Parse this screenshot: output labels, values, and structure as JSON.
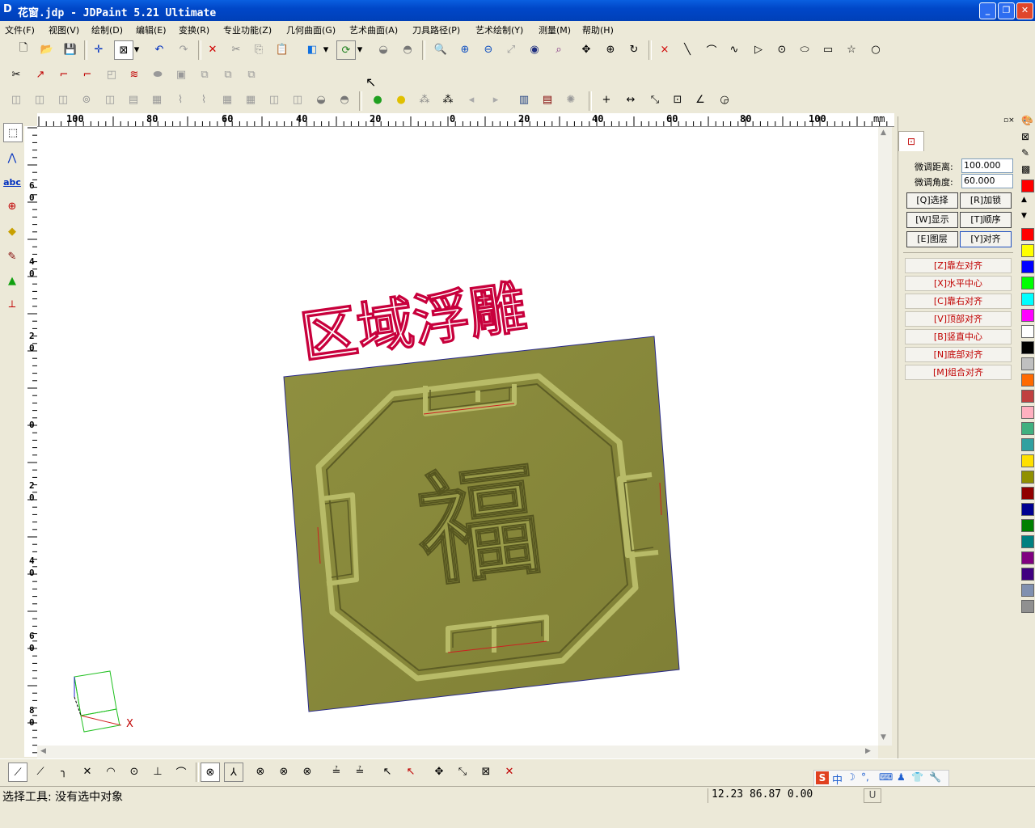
{
  "window": {
    "title": "花窗.jdp - JDPaint 5.21 Ultimate",
    "logo": "D"
  },
  "menu": [
    "文件(F)",
    "视图(V)",
    "绘制(D)",
    "编辑(E)",
    "变换(R)",
    "专业功能(Z)",
    "几何曲面(G)",
    "艺术曲面(A)",
    "刀具路径(P)",
    "艺术绘制(Y)",
    "测量(M)",
    "帮助(H)"
  ],
  "ruler": {
    "unit": "mm",
    "top_labels": [
      "100",
      "80",
      "60",
      "40",
      "20",
      "0",
      "20",
      "40",
      "60",
      "80",
      "100"
    ],
    "left_labels": [
      "6\n0",
      "4\n0",
      "2\n0",
      "0",
      "2\n0",
      "4\n0",
      "6\n0",
      "8\n0"
    ]
  },
  "canvas": {
    "title_text": "区域浮雕",
    "center_char": "福",
    "axis_x": "X"
  },
  "panel": {
    "dist_label": "微调距离:",
    "dist_value": "100.000",
    "angle_label": "微调角度:",
    "angle_value": "60.000",
    "buttons": [
      "[Q]选择",
      "[R]加锁",
      "[W]显示",
      "[T]顺序",
      "[E]图层",
      "[Y]对齐"
    ],
    "align": [
      "[Z]靠左对齐",
      "[X]水平中心",
      "[C]靠右对齐",
      "[V]顶部对齐",
      "[B]竖直中心",
      "[N]底部对齐",
      "[M]组合对齐"
    ]
  },
  "palette": [
    "#ff0000",
    "#ffff00",
    "#0000ff",
    "#00ff00",
    "#00ffff",
    "#ff00ff",
    "#ffffff",
    "#000000",
    "#c0c0c0",
    "#ff6a00",
    "#c04040",
    "#ffb0c0",
    "#40b080",
    "#30a0a0",
    "#ffe000",
    "#909000",
    "#900000",
    "#000090",
    "#008000",
    "#008080",
    "#800080",
    "#400080",
    "#8090b0",
    "#909090"
  ],
  "status": {
    "text": "选择工具: 没有选中对象",
    "coords": "12.23 86.87 0.00",
    "mode": "U"
  },
  "ime": {
    "label": "中"
  },
  "colors": {
    "relief": "#8a8a3c",
    "relief_light": "#b2b560",
    "outline": "#c8003c",
    "titlebar": "#0a5fe0"
  }
}
